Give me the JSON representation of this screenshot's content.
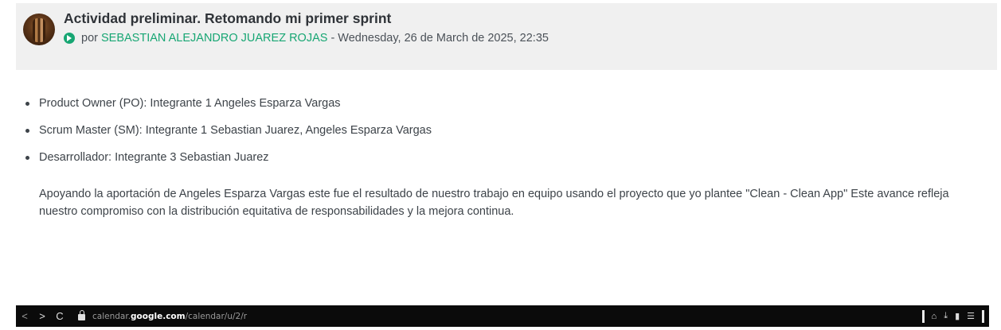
{
  "post": {
    "title": "Actividad preliminar. Retomando mi primer sprint",
    "by_prefix": "por",
    "author": "SEBASTIAN ALEJANDRO JUAREZ ROJAS",
    "separator": "-",
    "date": "Wednesday, 26 de March de 2025, 22:35",
    "roles": [
      "Product Owner (PO): Integrante 1 Angeles Esparza Vargas",
      "Scrum Master (SM): Integrante 1 Sebastian Juarez, Angeles Esparza Vargas",
      "Desarrollador: Integrante 3 Sebastian Juarez"
    ],
    "paragraph": "Apoyando la aportación de Angeles Esparza Vargas este fue el resultado de nuestro trabajo en equipo usando el proyecto que yo plantee \"Clean - Clean App\" Este avance refleja nuestro compromiso con la distribución equitativa de responsabilidades y la mejora continua."
  },
  "browser": {
    "back": "<",
    "forward": ">",
    "reload": "C",
    "url_prefix": "calendar.",
    "url_domain": "google.com",
    "url_path": "/calendar/u/2/r",
    "icons": [
      "profile-icon",
      "download-icon",
      "battery-icon",
      "menu-icon"
    ],
    "icon_glyphs": {
      "profile": "⌂",
      "download": "⤓",
      "battery": "▮",
      "menu": "☰"
    }
  },
  "colors": {
    "accent": "#17a673",
    "header_bg": "#f0f0f0",
    "bar_bg": "#0b0b0b"
  }
}
